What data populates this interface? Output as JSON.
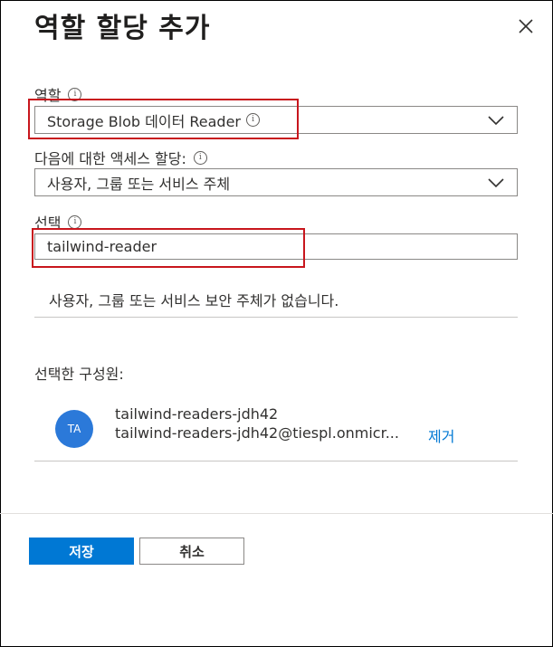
{
  "dialog": {
    "title": "역할 할당 추가"
  },
  "role": {
    "label": "역할",
    "selected": "Storage Blob 데이터 Reader"
  },
  "assign_access": {
    "label": "다음에 대한 액세스 할당:",
    "selected": "사용자, 그룹 또는 서비스 주체"
  },
  "select": {
    "label": "선택",
    "value": "tailwind-reader"
  },
  "results": {
    "empty_message": "사용자, 그룹 또는 서비스 보안 주체가 없습니다."
  },
  "selected_members": {
    "label": "선택한 구성원:",
    "member": {
      "initials": "TA",
      "name": "tailwind-readers-jdh42",
      "email": "tailwind-readers-jdh42@tiespl.onmicr...",
      "remove_label": "제거"
    }
  },
  "footer": {
    "save_label": "저장",
    "cancel_label": "취소"
  },
  "colors": {
    "accent": "#0078d4",
    "highlight": "#c8161d",
    "avatar": "#2b79d9"
  }
}
